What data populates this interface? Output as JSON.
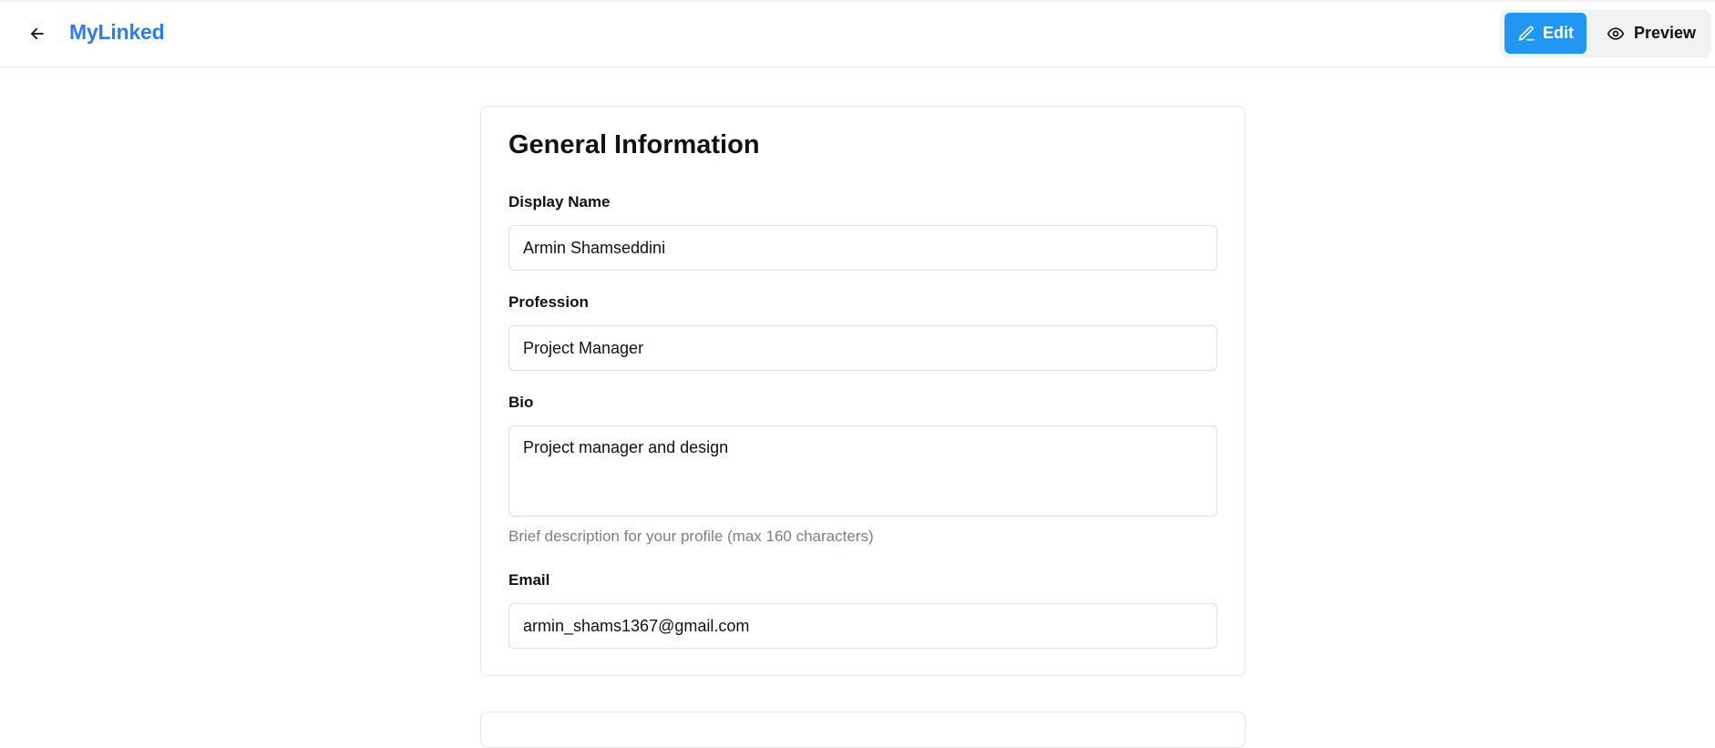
{
  "header": {
    "brand": "MyLinked",
    "back_icon": "arrow-left-icon",
    "modes": {
      "edit_label": "Edit",
      "edit_icon": "pencil-icon",
      "preview_label": "Preview",
      "preview_icon": "eye-icon",
      "active": "Edit"
    }
  },
  "general_info": {
    "title": "General Information",
    "display_name": {
      "label": "Display Name",
      "value": "Armin Shamseddini"
    },
    "profession": {
      "label": "Profession",
      "value": "Project Manager"
    },
    "bio": {
      "label": "Bio",
      "value": "Project manager and design",
      "helper": "Brief description for your profile (max 160 characters)"
    },
    "email": {
      "label": "Email",
      "value": "armin_shams1367@gmail.com"
    }
  },
  "colors": {
    "brand": "#2b7de9",
    "edit_button": "#2196f3",
    "helper_text": "#7a7f87"
  }
}
